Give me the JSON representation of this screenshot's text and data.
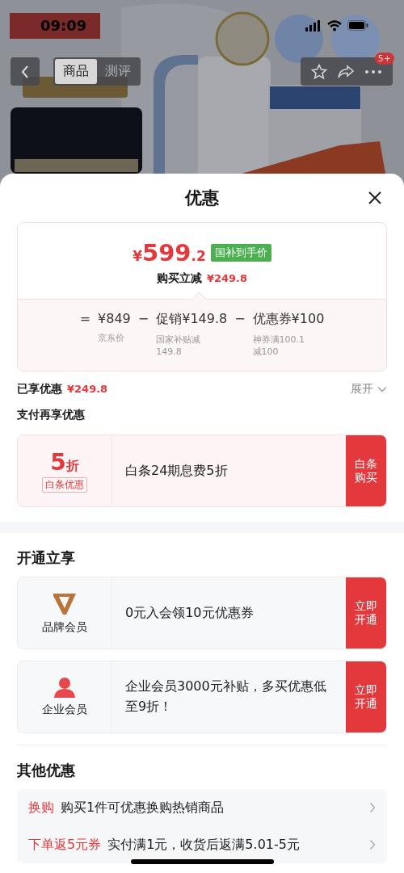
{
  "status_bar": {
    "time": "09:09"
  },
  "nav": {
    "tabs": [
      {
        "label": "商品",
        "selected": true
      },
      {
        "label": "测评",
        "selected": false
      }
    ],
    "badge": "5+"
  },
  "sheet": {
    "title": "优惠",
    "price": {
      "currency": "¥",
      "integer": "599",
      "decimal": ".2",
      "tag": "国补到手价",
      "saving_label": "购买立减",
      "saving_value": "¥249.8",
      "breakdown": [
        {
          "sign": "=",
          "value": "¥849",
          "note": "京东价"
        },
        {
          "sign": "−",
          "value": "促销¥149.8",
          "note": "国家补贴减149.8"
        },
        {
          "sign": "−",
          "value": "优惠券¥100",
          "note": "神券满100.1减100"
        }
      ]
    },
    "enjoyed": {
      "label": "已享优惠",
      "value": "¥249.8",
      "toggle": "展开",
      "expanded": false
    },
    "pay_section": {
      "title": "支付再享优惠",
      "offers": [
        {
          "kind": "discount",
          "number": "5",
          "unit": "折",
          "tag": "白条优惠",
          "text": "白条24期息费5折",
          "button": "白条购买"
        }
      ]
    },
    "open_section": {
      "title": "开通立享",
      "offers": [
        {
          "kind": "brand",
          "label": "品牌会员",
          "text": "0元入会领10元优惠券",
          "button": "立即开通"
        },
        {
          "kind": "enterprise",
          "label": "企业会员",
          "text": "企业会员3000元补贴，多买优惠低至9折！",
          "button": "立即开通"
        }
      ]
    },
    "other_section": {
      "title": "其他优惠",
      "rows": [
        {
          "tag": "换购",
          "text": "购买1件可优惠换购热销商品"
        },
        {
          "tag": "下单返5元券",
          "text": "实付满1元，收货后返满5.01-5元"
        }
      ]
    }
  }
}
